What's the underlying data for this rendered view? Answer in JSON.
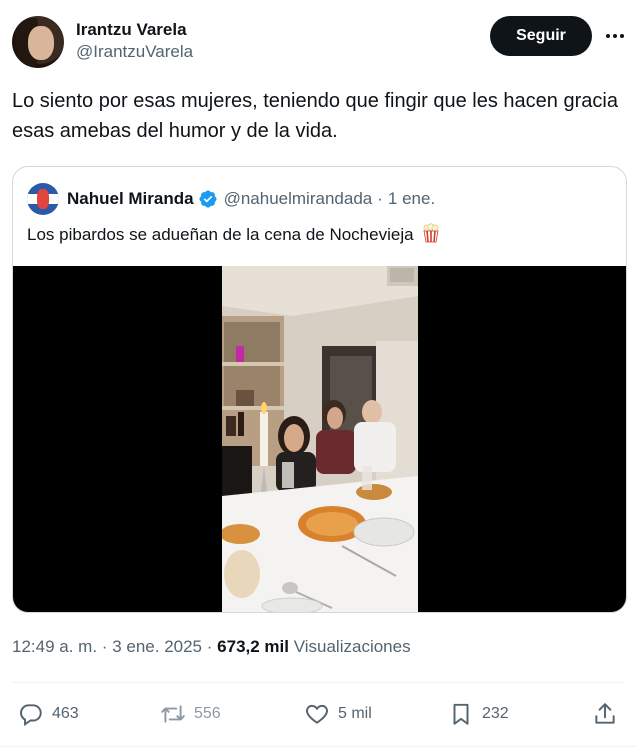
{
  "author": {
    "display_name": "Irantzu Varela",
    "handle": "@IrantzuVarela"
  },
  "follow_label": "Seguir",
  "tweet_text": "Lo siento por esas mujeres, teniendo que fingir que les hacen gracia esas amebas del humor y de la vida.",
  "quoted": {
    "display_name": "Nahuel Miranda",
    "handle": "@nahuelmirandada",
    "separator": "·",
    "date": "1 ene.",
    "text": "Los pibardos se adueñan de la cena de Nochevieja",
    "emoji_icon": "popcorn-icon",
    "verified_icon": "verified-badge-icon"
  },
  "meta": {
    "time": "12:49 a. m.",
    "sep1": "·",
    "date": "3 ene. 2025",
    "sep2": "·",
    "views_count": "673,2 mil",
    "views_label": "Visualizaciones"
  },
  "actions": {
    "replies": "463",
    "retweets": "556",
    "likes": "5 mil",
    "bookmarks": "232"
  },
  "colors": {
    "primary_text": "#0f1419",
    "secondary_text": "#536471",
    "verified_blue": "#1d9bf0",
    "border": "#cfd9de"
  }
}
